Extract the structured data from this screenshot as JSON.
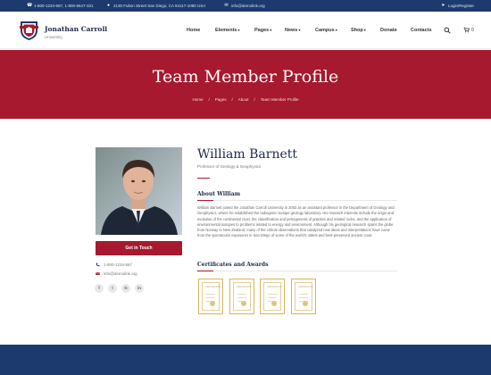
{
  "topbar": {
    "phone": "1-800-1234-567, 1-800-6547-321",
    "address": "2130 Fulton Street San Diego, CA 94117-1080 USA",
    "email": "info@demolink.org",
    "login": "Login/Register"
  },
  "header": {
    "brand_name": "Jonathan Carroll",
    "brand_sub": "University",
    "nav": [
      {
        "label": "Home",
        "dropdown": false
      },
      {
        "label": "Elements",
        "dropdown": true
      },
      {
        "label": "Pages",
        "dropdown": true
      },
      {
        "label": "News",
        "dropdown": true
      },
      {
        "label": "Campus",
        "dropdown": true
      },
      {
        "label": "Shop",
        "dropdown": true
      },
      {
        "label": "Donate",
        "dropdown": false
      },
      {
        "label": "Contacts",
        "dropdown": false
      }
    ],
    "cart_count": "0"
  },
  "hero": {
    "title": "Team Member Profile",
    "breadcrumb": [
      "Home",
      "/",
      "Pages",
      "/",
      "About",
      "/",
      "Team Member Profile"
    ]
  },
  "profile": {
    "name": "William Barnett",
    "role": "Professor of Geology & Geophysics",
    "button": "Get in Touch",
    "phone": "1-800-1234-567",
    "email": "info@demolink.org",
    "socials": [
      "f",
      "t",
      "G",
      "in"
    ],
    "about_heading": "About William",
    "bio": "William Barnett joined the Jonathan Carroll University in 2003 as an assistant professor in the Department of Geology and Geophysics, where he established the radiogenic isotope geology laboratory. His research interests include the origin and evolution of the continental crust, the classification and petrogenesis of granites and related rocks, and the application of environmental isotopes to problems related to energy and environment. Although his geological research spans the globe from Norway to New Zealand, many of the critical observations that catalyzed new ideas and interpretations have come from the spectacular exposures in San Diego of some of the world's oldest and best-preserved ancient crust.",
    "certs_heading": "Certificates and Awards",
    "cert_label": "CERTIFICATE"
  },
  "colors": {
    "navy": "#1c3a6e",
    "crimson": "#a6192e",
    "gold": "#d9b45a"
  }
}
